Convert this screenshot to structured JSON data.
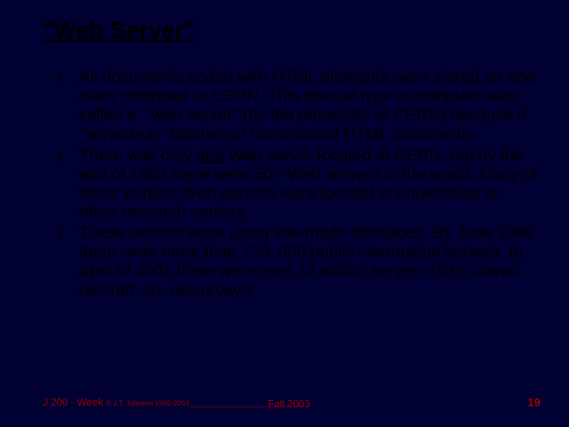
{
  "title": "\"Web Server\"",
  "bullets": {
    "b0": "All documents coded with HTML elements were stored on one main computer at CERN. This special type of computer was called a \" web server\" (by the physicists at CERN) because it \"served-up\" batches of cross-linked HTML documents.",
    "b1_pre": "There was only ",
    "b1_u": "one",
    "b1_post": " Web server located at CERN; but by the end of 1992 there were 50+ Web servers in the world. Many of these earliest Web servers were located at universities or other research centers.",
    "b2": "These servers were using line-mode interfaces. By June 1999 there were more than 720, 000 public information servers. In April of 2001 there were over 24 million servers (http: //www. netcraft. co. uk/survey/)."
  },
  "footer": {
    "left_prefix": "J 200 - Week ",
    "copyright": "© J.T. Johnson 1999-2003_____________________________",
    "center": "Fall 2003",
    "page": "19"
  },
  "marks": {
    "square": "§"
  }
}
